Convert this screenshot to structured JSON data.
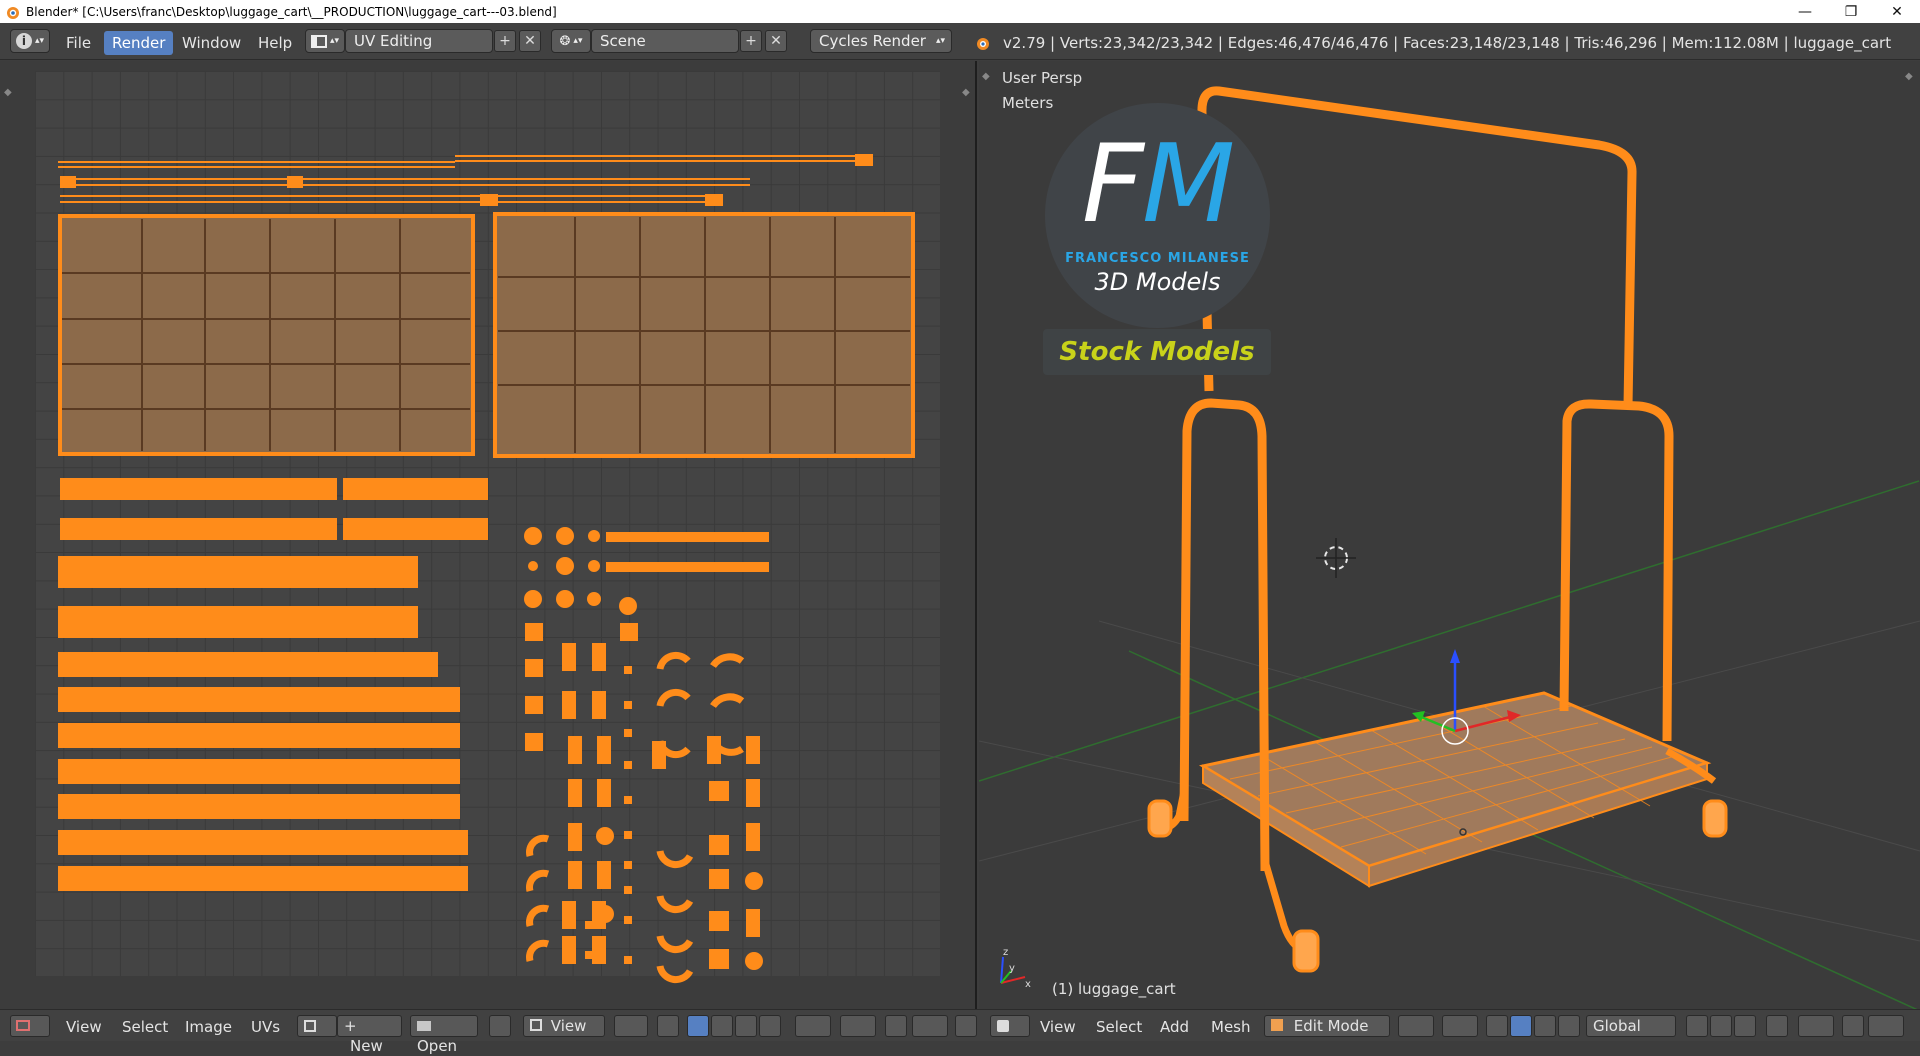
{
  "window": {
    "title": "Blender* [C:\\Users\\franc\\Desktop\\luggage_cart\\__PRODUCTION\\luggage_cart---03.blend]",
    "minimize": "—",
    "restore": "❐",
    "close": "✕"
  },
  "menu": {
    "info_icon": "i",
    "items": [
      "File",
      "Render",
      "Window",
      "Help"
    ],
    "active": "Render"
  },
  "screen_layout": {
    "value": "UV Editing",
    "add": "+",
    "remove": "✕"
  },
  "scene": {
    "value": "Scene",
    "add": "+",
    "remove": "✕"
  },
  "render_engine": {
    "value": "Cycles Render"
  },
  "stats": "v2.79 | Verts:23,342/23,342 | Edges:46,476/46,476 | Faces:23,148/23,148 | Tris:46,296 | Mem:112.08M | luggage_cart",
  "viewport": {
    "view_label": "User Persp",
    "units": "Meters",
    "object_label": "(1) luggage_cart",
    "logo": {
      "f": "F",
      "m": "M",
      "name": "FRANCESCO MILANESE",
      "tagline": "3D Models",
      "stock": "Stock Models"
    }
  },
  "uv_footer": {
    "items": [
      "View",
      "Select",
      "Image",
      "UVs"
    ],
    "new_label": "New",
    "open_label": "Open",
    "view_label": "View"
  },
  "viewport_footer": {
    "items": [
      "View",
      "Select",
      "Add",
      "Mesh"
    ],
    "mode": "Edit Mode",
    "orientation": "Global"
  },
  "colors": {
    "accent": "#ff8c1a",
    "selected_face": "#8c6a4a",
    "active_menu": "#5680c2",
    "logo_blue": "#2aa6e6",
    "logo_yellow": "#c8d21a"
  }
}
